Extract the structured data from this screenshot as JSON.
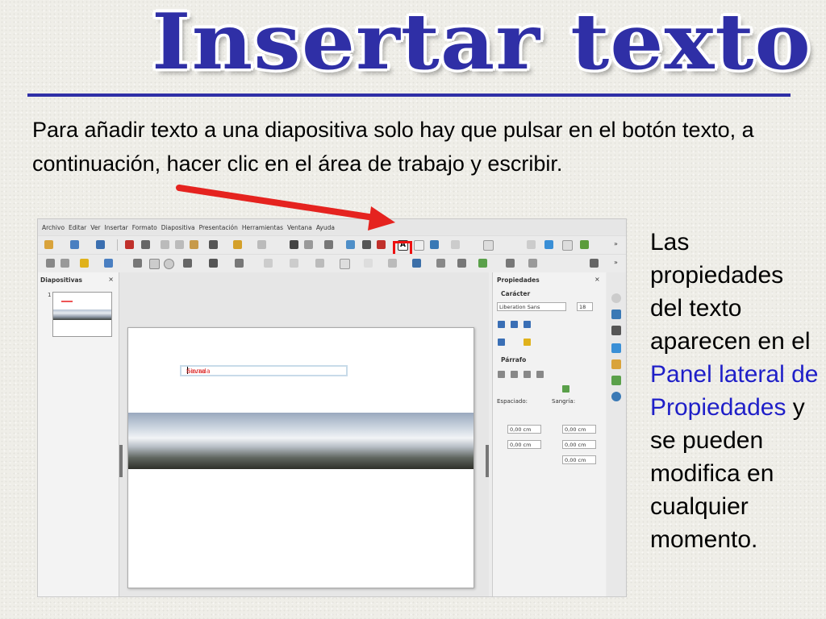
{
  "slide": {
    "title": "Insertar texto",
    "intro": "Para añadir texto a una diapositiva solo hay que pulsar en el botón texto, a continuación, hacer clic en el área de trabajo y escribir.",
    "side_text_1": "Las propiedades del texto aparecen en el ",
    "side_highlight": "Panel lateral de Propiedades",
    "side_text_2": " y se pueden modifica en cualquier momento.",
    "highlight_color": "#1f1fc8",
    "title_color": "#2f2fa6"
  },
  "app": {
    "menu": [
      "Archivo",
      "Editar",
      "Ver",
      "Insertar",
      "Formato",
      "Diapositiva",
      "Presentación",
      "Herramientas",
      "Ventana",
      "Ayuda"
    ],
    "left_panel": {
      "title": "Diapositivas",
      "close": "×",
      "slide_number": "1"
    },
    "textbox_text_before": "Sierra",
    "textbox_text_after": "nevada",
    "right_panel": {
      "title": "Propiedades",
      "close": "×",
      "section_char": "Carácter",
      "font_name": "Liberation Sans",
      "font_size": "18",
      "section_para": "Párrafo",
      "spacing_label": "Espaciado:",
      "indent_label": "Sangría:",
      "values": [
        "0,00 cm",
        "0,00 cm",
        "0,00 cm",
        "0,00 cm",
        "0,00 cm"
      ]
    }
  }
}
